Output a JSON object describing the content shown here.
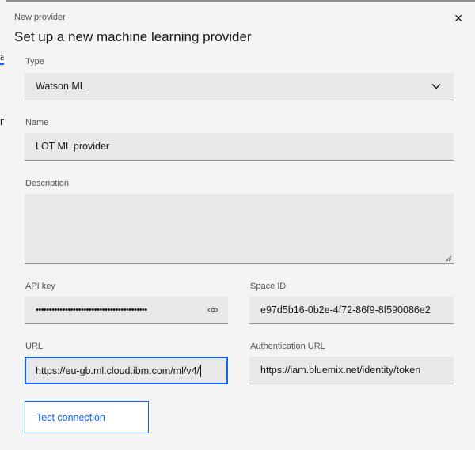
{
  "background": {
    "fragments": [
      "a",
      "n"
    ]
  },
  "modal": {
    "label": "New provider",
    "heading": "Set up a new machine learning provider",
    "close_icon": "close-icon"
  },
  "form": {
    "type": {
      "label": "Type",
      "value": "Watson ML"
    },
    "name": {
      "label": "Name",
      "value": "LOT ML provider"
    },
    "description": {
      "label": "Description",
      "value": ""
    },
    "api_key": {
      "label": "API key",
      "value": "••••••••••••••••••••••••••••••••••••••••••"
    },
    "space_id": {
      "label": "Space ID",
      "value": "e97d5b16-0b2e-4f72-86f9-8f590086e2"
    },
    "url": {
      "label": "URL",
      "value": "https://eu-gb.ml.cloud.ibm.com/ml/v4/"
    },
    "auth_url": {
      "label": "Authentication URL",
      "value": "https://iam.bluemix.net/identity/token"
    }
  },
  "actions": {
    "test_connection": "Test connection"
  },
  "colors": {
    "accent": "#0f62fe",
    "field_bg": "#e8e8e8",
    "modal_bg": "#f4f4f4",
    "overlay": "#8d8d8d"
  }
}
